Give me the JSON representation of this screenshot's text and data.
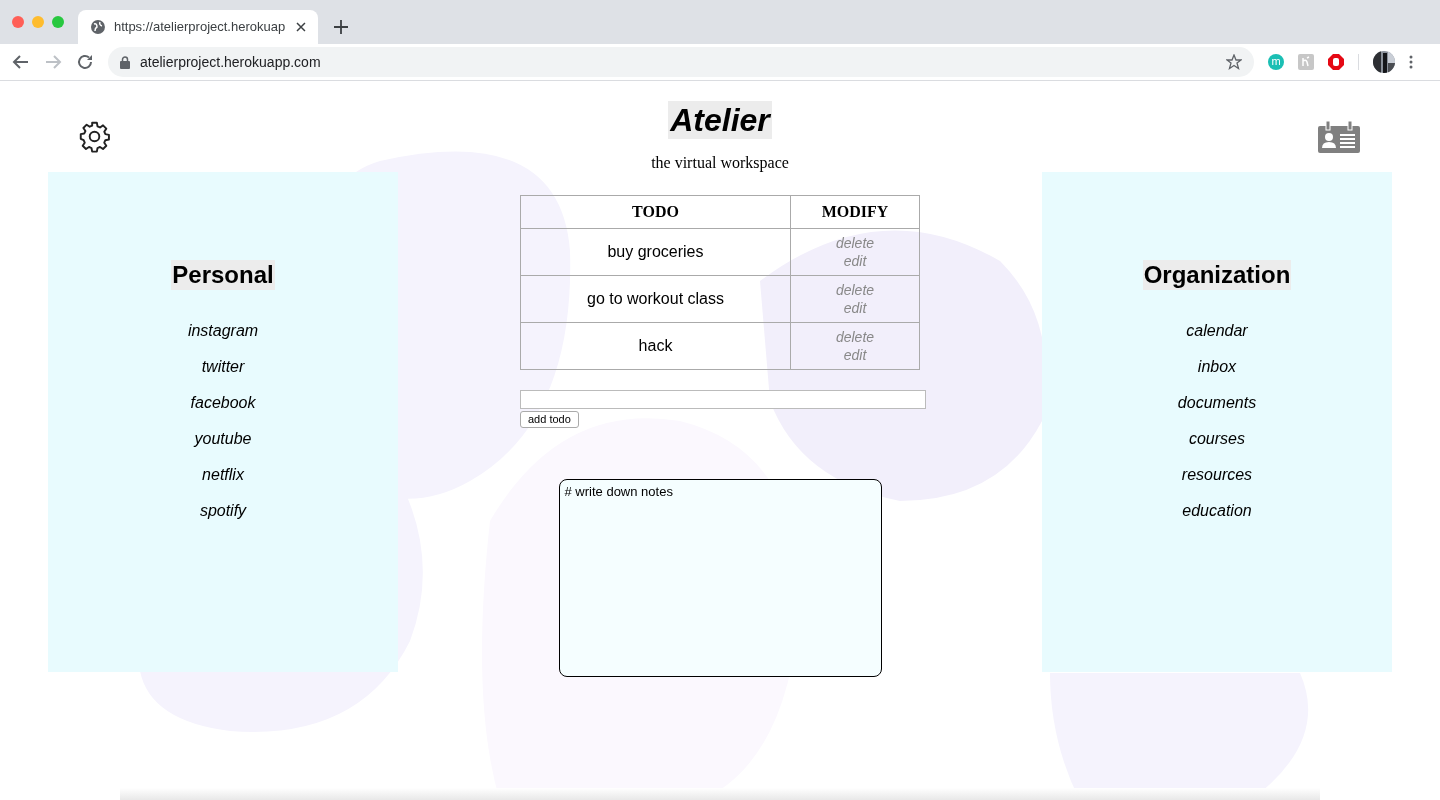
{
  "browser": {
    "tab_title": "https://atelierproject.herokuap",
    "url": "atelierproject.herokuapp.com",
    "extension_letter": "m"
  },
  "header": {
    "title": "Atelier",
    "subtitle": "the virtual workspace"
  },
  "personal": {
    "heading": "Personal",
    "links": [
      "instagram",
      "twitter",
      "facebook",
      "youtube",
      "netflix",
      "spotify"
    ]
  },
  "organization": {
    "heading": "Organization",
    "links": [
      "calendar",
      "inbox",
      "documents",
      "courses",
      "resources",
      "education"
    ]
  },
  "todo_table": {
    "columns": [
      "TODO",
      "MODIFY"
    ],
    "rows": [
      {
        "task": "buy groceries",
        "actions": [
          "delete",
          "edit"
        ]
      },
      {
        "task": "go to workout class",
        "actions": [
          "delete",
          "edit"
        ]
      },
      {
        "task": "hack",
        "actions": [
          "delete",
          "edit"
        ]
      }
    ]
  },
  "add_todo": {
    "button": "add todo"
  },
  "notes": {
    "placeholder": "# write down notes"
  }
}
